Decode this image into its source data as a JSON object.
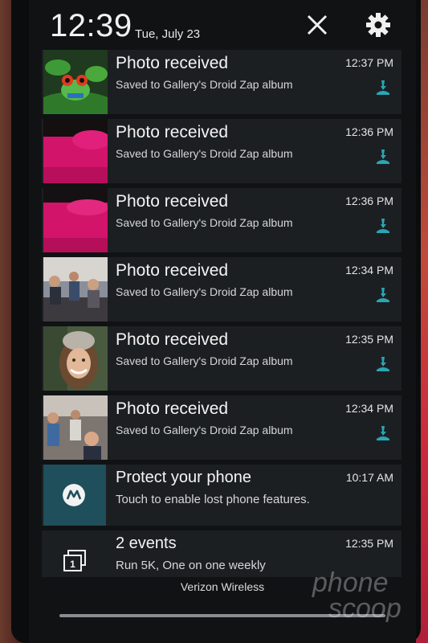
{
  "status": {
    "time": "12:39",
    "date": "Tue, July 23"
  },
  "header": {
    "clear_icon": "close-icon",
    "settings_icon": "gear-icon"
  },
  "notifications": [
    {
      "title": "Photo received",
      "subtitle": "Saved to Gallery's Droid Zap album",
      "time": "12:37 PM",
      "thumb": "frog"
    },
    {
      "title": "Photo received",
      "subtitle": "Saved to Gallery's Droid Zap album",
      "time": "12:36 PM",
      "thumb": "magenta"
    },
    {
      "title": "Photo received",
      "subtitle": "Saved to Gallery's Droid Zap album",
      "time": "12:36 PM",
      "thumb": "magenta"
    },
    {
      "title": "Photo received",
      "subtitle": "Saved to Gallery's Droid Zap album",
      "time": "12:34 PM",
      "thumb": "crowd"
    },
    {
      "title": "Photo received",
      "subtitle": "Saved to Gallery's Droid Zap album",
      "time": "12:35 PM",
      "thumb": "woman"
    },
    {
      "title": "Photo received",
      "subtitle": "Saved to Gallery's Droid Zap album",
      "time": "12:34 PM",
      "thumb": "crowd2"
    }
  ],
  "protect": {
    "title": "Protect your phone",
    "subtitle": "Touch to enable lost phone features.",
    "time": "10:17 AM"
  },
  "events": {
    "title": "2 events",
    "subtitle": "Run 5K, One on one weekly",
    "time": "12:35 PM",
    "badge": "1"
  },
  "carrier": "Verizon Wireless",
  "watermark": {
    "line1": "phone",
    "line2": "scoop"
  },
  "colors": {
    "accent_teal": "#2aa6b4",
    "moto_blue": "#1e4f5b",
    "card_bg": "#1c1f22"
  }
}
